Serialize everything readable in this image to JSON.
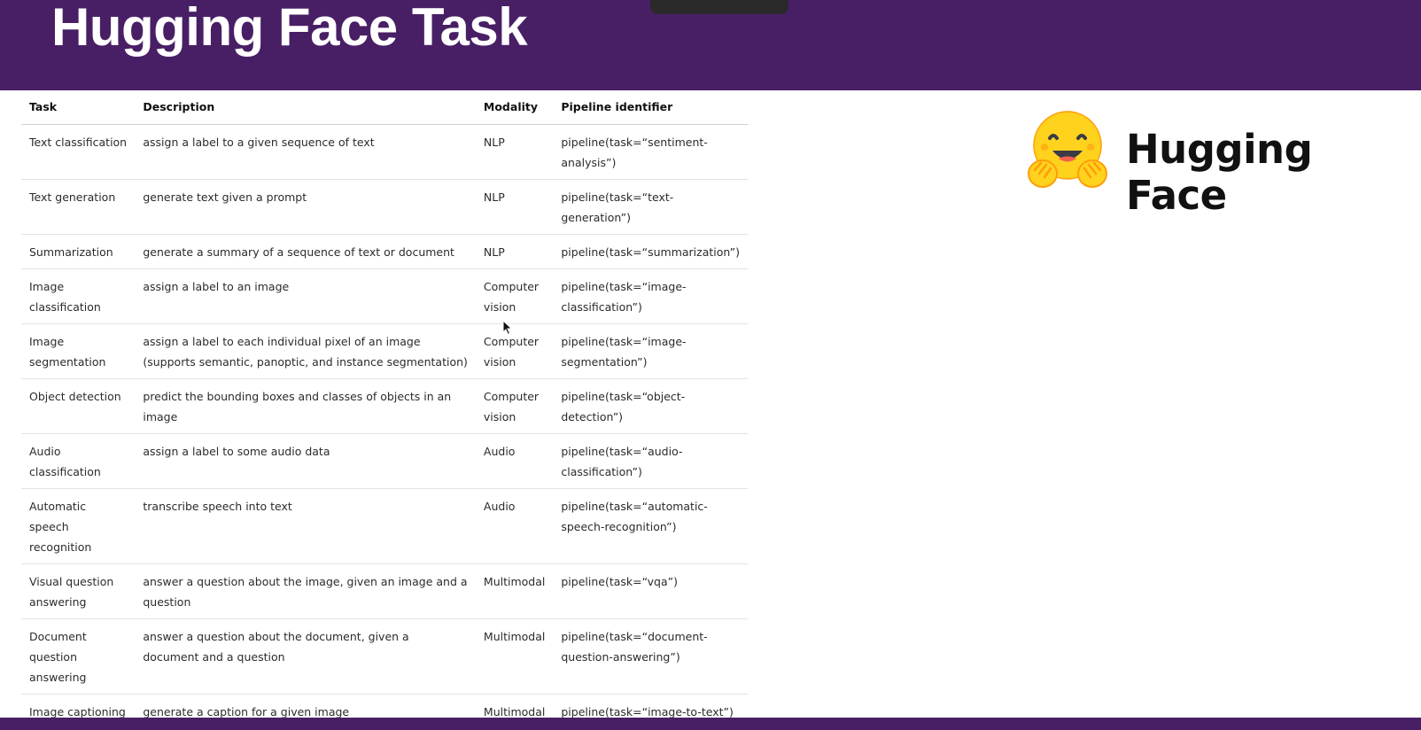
{
  "slide": {
    "title": "Hugging Face Task",
    "brand_name": "Hugging Face"
  },
  "colors": {
    "header_bg": "#481f65",
    "title_text": "#ffffff",
    "logo_yellow": "#ffd21e",
    "logo_orange": "#ff9d0b"
  },
  "icons": {
    "logo": "hugging-face-emoji-logo",
    "cursor": "mouse-pointer-icon"
  },
  "table": {
    "headers": {
      "task": "Task",
      "description": "Description",
      "modality": "Modality",
      "pipeline": "Pipeline identifier"
    },
    "rows": [
      {
        "task": "Text classification",
        "description": "assign a label to a given sequence of text",
        "modality": "NLP",
        "pipeline": "pipeline(task=“sentiment-analysis”)"
      },
      {
        "task": "Text generation",
        "description": "generate text given a prompt",
        "modality": "NLP",
        "pipeline": "pipeline(task=“text-generation”)"
      },
      {
        "task": "Summarization",
        "description": "generate a summary of a sequence of text or document",
        "modality": "NLP",
        "pipeline": "pipeline(task=“summarization”)"
      },
      {
        "task": "Image classification",
        "description": "assign a label to an image",
        "modality": "Computer vision",
        "pipeline": "pipeline(task=“image-classification”)"
      },
      {
        "task": "Image segmentation",
        "description": "assign a label to each individual pixel of an image (supports semantic, panoptic, and instance segmentation)",
        "modality": "Computer vision",
        "pipeline": "pipeline(task=“image-segmentation”)"
      },
      {
        "task": "Object detection",
        "description": "predict the bounding boxes and classes of objects in an image",
        "modality": "Computer vision",
        "pipeline": "pipeline(task=“object-detection”)"
      },
      {
        "task": "Audio classification",
        "description": "assign a label to some audio data",
        "modality": "Audio",
        "pipeline": "pipeline(task=“audio-classification”)"
      },
      {
        "task": "Automatic speech recognition",
        "description": "transcribe speech into text",
        "modality": "Audio",
        "pipeline": "pipeline(task=“automatic-speech-recognition”)"
      },
      {
        "task": "Visual question answering",
        "description": "answer a question about the image, given an image and a question",
        "modality": "Multimodal",
        "pipeline": "pipeline(task=“vqa”)"
      },
      {
        "task": "Document question answering",
        "description": "answer a question about the document, given a document and a question",
        "modality": "Multimodal",
        "pipeline": "pipeline(task=“document-question-answering”)"
      },
      {
        "task": "Image captioning",
        "description": "generate a caption for a given image",
        "modality": "Multimodal",
        "pipeline": "pipeline(task=“image-to-text”)"
      }
    ]
  }
}
